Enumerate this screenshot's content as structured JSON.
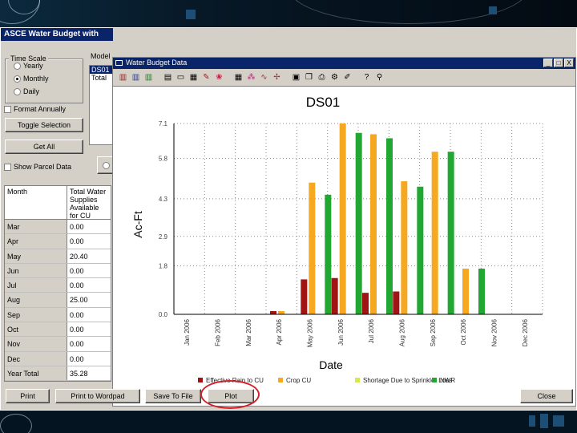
{
  "app": {
    "title": "ASCE Water Budget with",
    "model_label": "Model",
    "model_items": [
      "DS01",
      "Total"
    ],
    "time_scale": {
      "label": "Time Scale",
      "options": [
        "Yearly",
        "Monthly",
        "Daily"
      ],
      "selected": "Monthly"
    },
    "format_annually": "Format Annually",
    "toggle_selection": "Toggle Selection",
    "get_all": "Get All",
    "show_parcel_data": "Show Parcel Data"
  },
  "table": {
    "headers": [
      "Month",
      "Total Water Supplies Available for CU"
    ],
    "rows": [
      [
        "Mar",
        "0.00"
      ],
      [
        "Apr",
        "0.00"
      ],
      [
        "May",
        "20.40"
      ],
      [
        "Jun",
        "0.00"
      ],
      [
        "Jul",
        "0.00"
      ],
      [
        "Aug",
        "25.00"
      ],
      [
        "Sep",
        "0.00"
      ],
      [
        "Oct",
        "0.00"
      ],
      [
        "Nov",
        "0.00"
      ],
      [
        "Dec",
        "0.00"
      ],
      [
        "Year Total",
        "35.28"
      ]
    ]
  },
  "child_window": {
    "title": "Water Budget Data",
    "buttons": [
      "_",
      "□",
      "X"
    ]
  },
  "bottom_buttons": {
    "print": "Print",
    "wordpad": "Print to Wordpad",
    "save": "Save To File",
    "plot": "Plot",
    "close": "Close"
  },
  "chart_data": {
    "type": "bar",
    "title": "DS01",
    "xlabel": "Date",
    "ylabel": "Ac-Ft",
    "ylim": [
      0,
      7.1
    ],
    "yticks": [
      "0.0",
      "1.8",
      "2.9",
      "4.3",
      "5.8",
      "7.1"
    ],
    "ytick_values": [
      0,
      1.8,
      2.9,
      4.3,
      5.8,
      7.1
    ],
    "categories": [
      "Jan 2006",
      "Feb 2006",
      "Mar 2006",
      "Apr 2006",
      "May 2006",
      "Jun 2006",
      "Jul 2006",
      "Aug 2006",
      "Sep 2006",
      "Oct 2006",
      "Nov 2006",
      "Dec 2006"
    ],
    "series": [
      {
        "name": "Effective Rain to CU",
        "color": "#a01414",
        "values": [
          0,
          0,
          0,
          0.12,
          1.3,
          1.35,
          0.8,
          0.85,
          0,
          0,
          0,
          0
        ]
      },
      {
        "name": "Crop CU",
        "color": "#f5a820",
        "values": [
          0,
          0,
          0,
          0.12,
          4.9,
          7.1,
          6.7,
          4.95,
          6.05,
          1.7,
          0,
          0
        ]
      },
      {
        "name": "Shortage Due to Sprinkler Loss",
        "color": "#d8e84a",
        "values": [
          0,
          0,
          0,
          0,
          0,
          0,
          0,
          0,
          0,
          0,
          0,
          0
        ]
      },
      {
        "name": "NWR",
        "color": "#22a832",
        "values": [
          0,
          0,
          0,
          0,
          4.45,
          6.75,
          6.55,
          4.75,
          6.05,
          1.7,
          0,
          0
        ]
      }
    ],
    "grid": true,
    "legend_position": "bottom"
  }
}
